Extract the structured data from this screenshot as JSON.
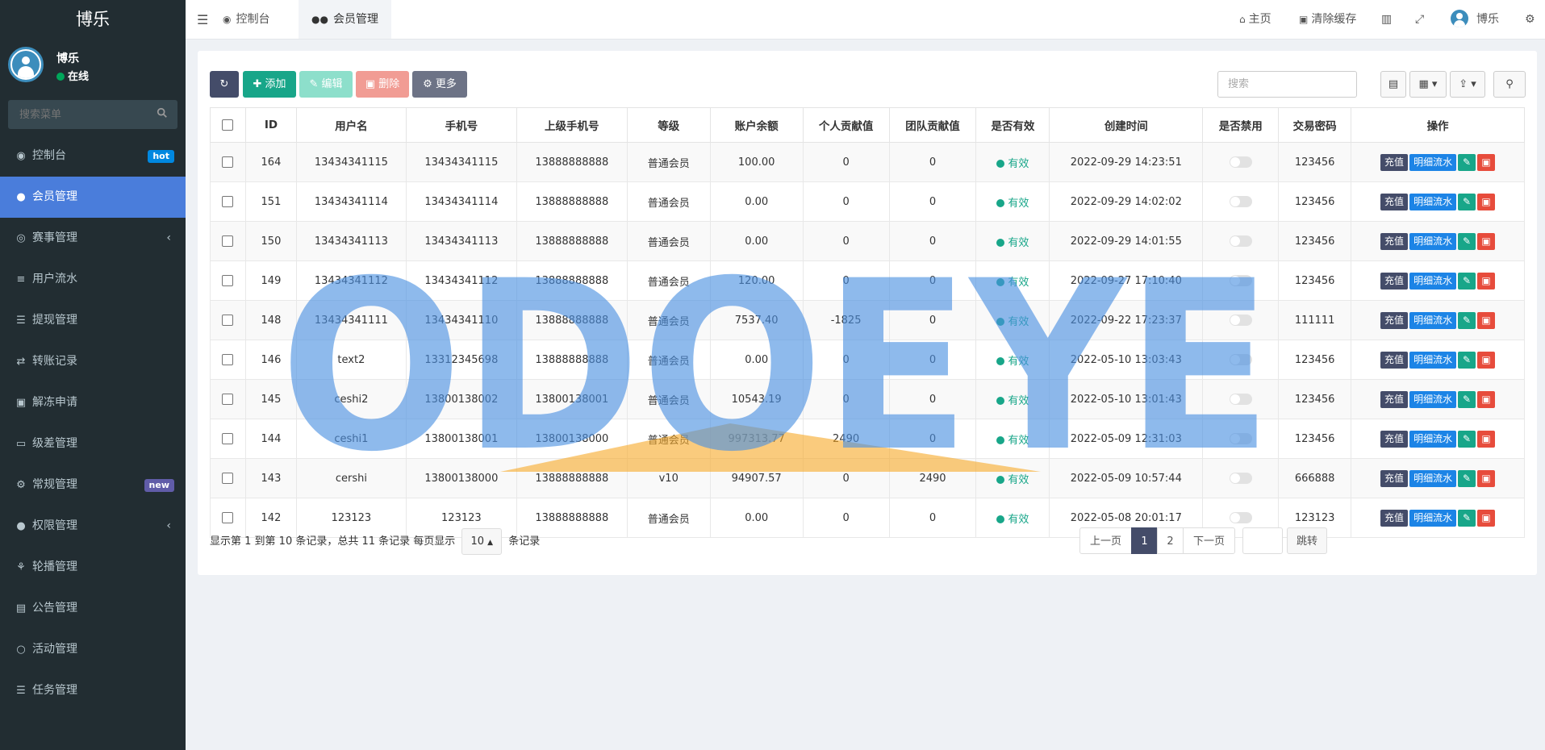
{
  "app": {
    "brand": "博乐"
  },
  "user": {
    "name": "博乐",
    "status": "在线"
  },
  "sidebar": {
    "search_placeholder": "搜索菜单",
    "items": [
      {
        "label": "控制台",
        "icon": "dashboard-icon",
        "badge": "hot"
      },
      {
        "label": "会员管理",
        "icon": "users-icon",
        "active": true
      },
      {
        "label": "赛事管理",
        "icon": "globe-icon",
        "expandable": true
      },
      {
        "label": "用户流水",
        "icon": "list-icon"
      },
      {
        "label": "提现管理",
        "icon": "list-ol-icon"
      },
      {
        "label": "转账记录",
        "icon": "transfer-icon"
      },
      {
        "label": "解冻申请",
        "icon": "picture-icon"
      },
      {
        "label": "级差管理",
        "icon": "window-icon"
      },
      {
        "label": "常规管理",
        "icon": "cogs-icon",
        "badge": "new"
      },
      {
        "label": "权限管理",
        "icon": "group-icon",
        "expandable": true
      },
      {
        "label": "轮播管理",
        "icon": "carousel-icon"
      },
      {
        "label": "公告管理",
        "icon": "notice-icon"
      },
      {
        "label": "活动管理",
        "icon": "circle-icon"
      },
      {
        "label": "任务管理",
        "icon": "tasks-icon"
      }
    ]
  },
  "topbar": {
    "tabs": [
      {
        "label": "控制台",
        "icon": "dashboard-icon"
      },
      {
        "label": "会员管理",
        "icon": "users-icon",
        "active": true
      }
    ],
    "home": "主页",
    "clear_cache": "清除缓存",
    "user": "博乐"
  },
  "toolbar": {
    "add": "添加",
    "edit": "编辑",
    "delete": "删除",
    "more": "更多",
    "search_placeholder": "搜索"
  },
  "table": {
    "columns": [
      "ID",
      "用户名",
      "手机号",
      "上级手机号",
      "等级",
      "账户余额",
      "个人贡献值",
      "团队贡献值",
      "是否有效",
      "创建时间",
      "是否禁用",
      "交易密码",
      "操作"
    ],
    "rows": [
      {
        "id": "164",
        "username": "13434341115",
        "phone": "13434341115",
        "parent_phone": "13888888888",
        "level": "普通会员",
        "balance": "100.00",
        "personal": "0",
        "team": "0",
        "valid": "有效",
        "created": "2022-09-29 14:23:51",
        "disabled": false,
        "pwd": "123456"
      },
      {
        "id": "151",
        "username": "13434341114",
        "phone": "13434341114",
        "parent_phone": "13888888888",
        "level": "普通会员",
        "balance": "0.00",
        "personal": "0",
        "team": "0",
        "valid": "有效",
        "created": "2022-09-29 14:02:02",
        "disabled": false,
        "pwd": "123456"
      },
      {
        "id": "150",
        "username": "13434341113",
        "phone": "13434341113",
        "parent_phone": "13888888888",
        "level": "普通会员",
        "balance": "0.00",
        "personal": "0",
        "team": "0",
        "valid": "有效",
        "created": "2022-09-29 14:01:55",
        "disabled": false,
        "pwd": "123456"
      },
      {
        "id": "149",
        "username": "13434341112",
        "phone": "13434341112",
        "parent_phone": "13888888888",
        "level": "普通会员",
        "balance": "120.00",
        "personal": "0",
        "team": "0",
        "valid": "有效",
        "created": "2022-09-27 17:10:40",
        "disabled": false,
        "pwd": "123456"
      },
      {
        "id": "148",
        "username": "13434341111",
        "phone": "13434341110",
        "parent_phone": "13888888888",
        "level": "普通会员",
        "balance": "7537.40",
        "personal": "-1825",
        "team": "0",
        "valid": "有效",
        "created": "2022-09-22 17:23:37",
        "disabled": false,
        "pwd": "111111"
      },
      {
        "id": "146",
        "username": "text2",
        "phone": "13312345698",
        "parent_phone": "13888888888",
        "level": "普通会员",
        "balance": "0.00",
        "personal": "0",
        "team": "0",
        "valid": "有效",
        "created": "2022-05-10 13:03:43",
        "disabled": false,
        "pwd": "123456"
      },
      {
        "id": "145",
        "username": "ceshi2",
        "phone": "13800138002",
        "parent_phone": "13800138001",
        "level": "普通会员",
        "balance": "10543.19",
        "personal": "0",
        "team": "0",
        "valid": "有效",
        "created": "2022-05-10 13:01:43",
        "disabled": false,
        "pwd": "123456"
      },
      {
        "id": "144",
        "username": "ceshi1",
        "phone": "13800138001",
        "parent_phone": "13800138000",
        "level": "普通会员",
        "balance": "997313.77",
        "personal": "2490",
        "team": "0",
        "valid": "有效",
        "created": "2022-05-09 12:31:03",
        "disabled": false,
        "pwd": "123456"
      },
      {
        "id": "143",
        "username": "cershi",
        "phone": "13800138000",
        "parent_phone": "13888888888",
        "level": "v10",
        "balance": "94907.57",
        "personal": "0",
        "team": "2490",
        "valid": "有效",
        "created": "2022-05-09 10:57:44",
        "disabled": false,
        "pwd": "666888"
      },
      {
        "id": "142",
        "username": "123123",
        "phone": "123123",
        "parent_phone": "13888888888",
        "level": "普通会员",
        "balance": "0.00",
        "personal": "0",
        "team": "0",
        "valid": "有效",
        "created": "2022-05-08 20:01:17",
        "disabled": false,
        "pwd": "123123"
      }
    ],
    "actions": {
      "charge": "充值",
      "detail": "明细流水"
    }
  },
  "pagination": {
    "summary_prefix": "显示第 1 到第 10 条记录，总共 11 条记录 每页显示",
    "page_size": "10",
    "summary_suffix": "条记录",
    "prev": "上一页",
    "pages": [
      "1",
      "2"
    ],
    "current": "1",
    "next": "下一页",
    "jump": "跳转"
  },
  "watermark": {
    "text": "ODOEYE",
    "color": "#4a90e2"
  },
  "colors": {
    "sidebar_bg": "#222d32",
    "active_menu": "#4a7ddb",
    "primary_dark": "#444c69",
    "success": "#18a689",
    "info": "#1c84e6",
    "danger": "#e74c3c"
  }
}
